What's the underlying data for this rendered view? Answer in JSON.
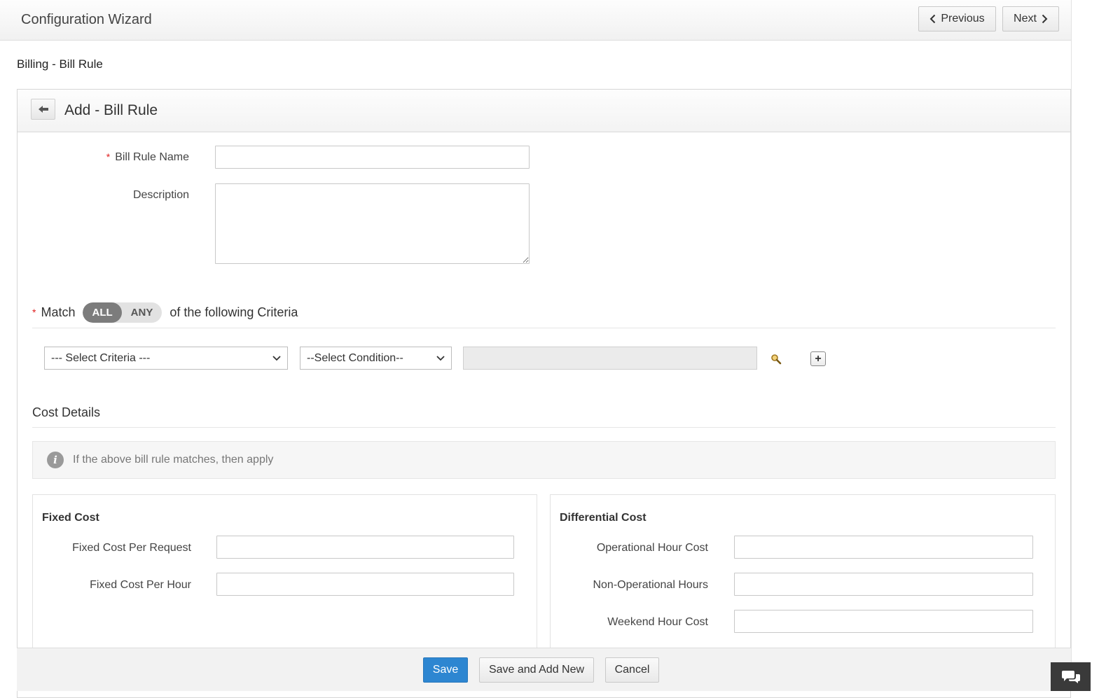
{
  "header": {
    "title": "Configuration Wizard",
    "previous_label": "Previous",
    "next_label": "Next"
  },
  "breadcrumb": "Billing -  Bill Rule",
  "form": {
    "title": "Add - Bill Rule",
    "bill_rule_name_label": "Bill Rule Name",
    "bill_rule_name_value": "",
    "description_label": "Description",
    "description_value": ""
  },
  "criteria": {
    "match_label": "Match",
    "toggle_all": "ALL",
    "toggle_any": "ANY",
    "selected": "ALL",
    "suffix": "of the following Criteria",
    "criteria_select": "--- Select Criteria ---",
    "condition_select": "--Select Condition--",
    "value": ""
  },
  "cost": {
    "section_title": "Cost Details",
    "info_text": "If the above bill rule matches, then apply",
    "fixed": {
      "title": "Fixed Cost",
      "per_request_label": "Fixed Cost Per Request",
      "per_request_value": "",
      "per_hour_label": "Fixed Cost Per Hour",
      "per_hour_value": ""
    },
    "differential": {
      "title": "Differential Cost",
      "operational_label": "Operational Hour Cost",
      "operational_value": "",
      "non_operational_label": "Non-Operational Hours",
      "non_operational_value": "",
      "weekend_label": "Weekend Hour Cost",
      "weekend_value": ""
    }
  },
  "footer": {
    "save_label": "Save",
    "save_add_new_label": "Save and Add New",
    "cancel_label": "Cancel"
  },
  "colors": {
    "primary_button": "#2d86d1",
    "required_asterisk": "#e02020",
    "toggle_active": "#7c7c7c",
    "chat_button": "#3a3a3a"
  },
  "icons": {
    "back": "arrow-left-icon",
    "search": "search-icon",
    "add": "plus-icon",
    "info": "info-icon",
    "chat": "chat-icon"
  }
}
